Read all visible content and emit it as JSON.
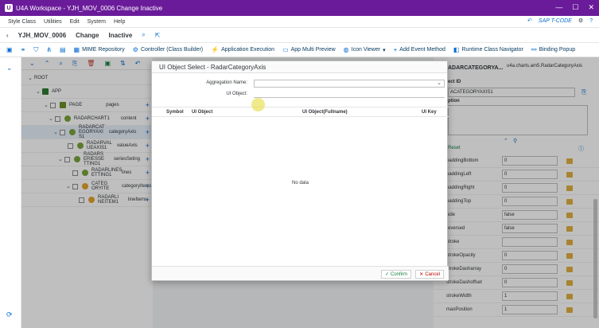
{
  "window": {
    "title": "U4A Workspace - YJH_MOV_0006 Change Inactive"
  },
  "menu": {
    "items": [
      "Style Class",
      "Utilities",
      "Edit",
      "System",
      "Help"
    ],
    "tcode": "SAP T-CODE"
  },
  "header": {
    "app_id": "YJH_MOV_0006",
    "mode": "Change",
    "status": "Inactive"
  },
  "toolbar": {
    "mime": "MIME Repository",
    "controller": "Controller (Class Builder)",
    "app_exec": "Application Execution",
    "app_multi": "App Multi Preview",
    "icon_viewer": "Icon Viewer",
    "add_event": "Add Event Method",
    "runtime": "Runtime Class Navigator",
    "binding": "Binding Popup"
  },
  "tree": {
    "root": "ROOT",
    "app": "APP",
    "page": "PAGE",
    "page_agg": "pages",
    "chart": "RADARCHART1",
    "chart_agg": "content",
    "cat_axis": "RADARCAT EGORYAXI S1",
    "cat_axis_agg": "categoryAxis",
    "val_axis": "RADARVAL UEAXIS1",
    "val_axis_agg": "valueAxis",
    "series": "RADARS ERIESSE TTING1",
    "series_agg": "seriesSeting",
    "lines": "RADARLINES ETTING1",
    "lines_agg": "lines",
    "cat_item": "CATEG ORYITE",
    "cat_item_agg": "categoryItems",
    "line_item": "RADARLI NEITEM1",
    "line_item_agg": "lineItems"
  },
  "dialog": {
    "title": "UI Object Select - RadarCategoryAxis",
    "agg_label": "Aggregation Name:",
    "uiobj_label": "UI Object:",
    "col_symbol": "Symbol",
    "col_uiobject": "UI Object",
    "col_full": "UI Object(Fullname)",
    "col_key": "UI Key",
    "no_data": "No data",
    "confirm": "Confirm",
    "cancel": "Cancel"
  },
  "right": {
    "class_name": "u4a.charts.am5.RadarCategoryAxis",
    "header_name": "ADARCATEGORYA...",
    "obj_id_label": "ect ID",
    "obj_id_value": "ACATEGORYAXIS1",
    "desc_label": "ption",
    "reset": "Reset",
    "props": [
      {
        "name": "paddingBottom",
        "value": "0"
      },
      {
        "name": "paddingLeft",
        "value": "0"
      },
      {
        "name": "paddingRight",
        "value": "0"
      },
      {
        "name": "paddingTop",
        "value": "0"
      },
      {
        "name": "side",
        "value": "false"
      },
      {
        "name": "reversed",
        "value": "false"
      },
      {
        "name": "stroke",
        "value": ""
      },
      {
        "name": "strokeOpacity",
        "value": "0"
      },
      {
        "name": "strokeDasharray",
        "value": "0"
      },
      {
        "name": "strokeDashoffset",
        "value": "0"
      },
      {
        "name": "strokeWidth",
        "value": "1"
      },
      {
        "name": "maxPosition",
        "value": "1"
      }
    ]
  }
}
